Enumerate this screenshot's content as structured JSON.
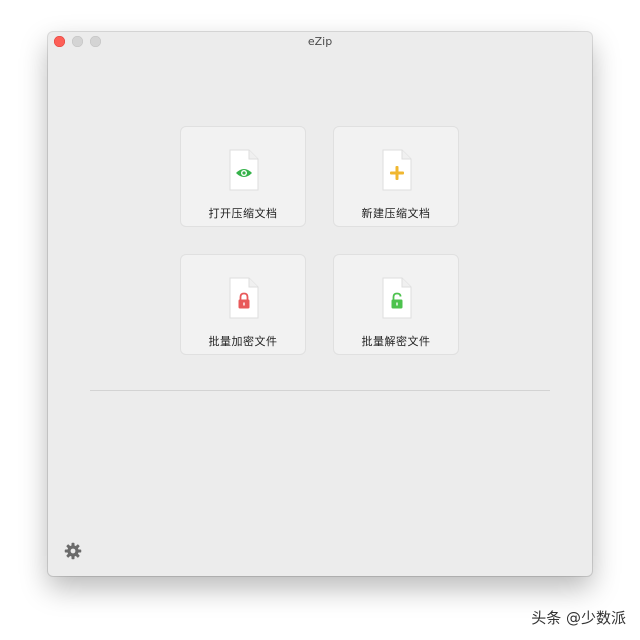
{
  "window": {
    "title": "eZip"
  },
  "actions": [
    {
      "label": "打开压缩文档",
      "icon": "eye-icon",
      "color": "#35b24a"
    },
    {
      "label": "新建压缩文档",
      "icon": "plus-icon",
      "color": "#f0b72f"
    },
    {
      "label": "批量加密文件",
      "icon": "locked-padlock-icon",
      "color": "#e8595a"
    },
    {
      "label": "批量解密文件",
      "icon": "unlocked-padlock-icon",
      "color": "#4cc24d"
    }
  ],
  "settings": {
    "icon": "gear-icon"
  },
  "watermark": {
    "text": "头条 @少数派"
  }
}
